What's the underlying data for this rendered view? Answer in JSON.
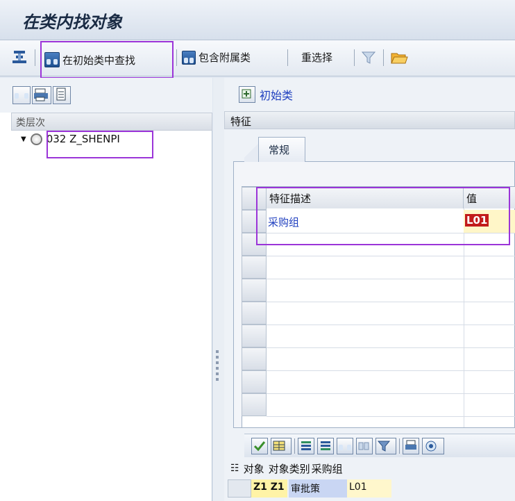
{
  "window": {
    "title": "在类内找对象"
  },
  "toolbar": {
    "find_in_initial_class": "在初始类中查找",
    "include_subclasses": "包含附属类",
    "reselect": "重选择"
  },
  "left": {
    "hierarchy_header": "类层次",
    "tree": [
      {
        "label": "032 Z_SHENPI",
        "expanded": true
      }
    ]
  },
  "right": {
    "initial_class_link": "初始类",
    "characteristics_header": "特征",
    "tab_label": "常规",
    "table": {
      "columns": [
        "特征描述",
        "值"
      ],
      "rows": [
        {
          "description": "采购组",
          "value": "L01"
        }
      ]
    }
  },
  "results": {
    "columns": [
      "对象",
      "对象类别",
      "采购组"
    ],
    "rows": [
      {
        "object": "Z1 Z1",
        "category": "审批策",
        "purchasing_group": "L01"
      }
    ]
  },
  "colors": {
    "highlight": "#9b34d8",
    "link": "#1f3fbf",
    "value_bg": "#c21b1b"
  }
}
